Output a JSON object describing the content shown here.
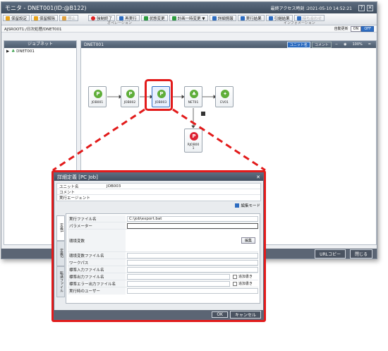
{
  "window": {
    "title": "モニタ - DNET001(ID:@B122)",
    "last_access": "最終アクセス時刻 :2021-05-10 14:52:21"
  },
  "toolbar": {
    "buttons": [
      {
        "label": "保留設定",
        "color": "#e6a21c",
        "disabled": false
      },
      {
        "label": "保留解除",
        "color": "#e6a21c",
        "disabled": false
      },
      {
        "label": "停止",
        "color": "#bbbbbb",
        "disabled": true
      },
      {
        "label": "強制終了",
        "color": "#d22",
        "disabled": false
      },
      {
        "label": "再実行",
        "color": "#2d6cc0",
        "disabled": false
      },
      {
        "label": "状態変更",
        "color": "#2d9a3f",
        "disabled": false
      },
      {
        "label": "計画一時変更 ▼",
        "color": "#2d9a3f",
        "disabled": false
      },
      {
        "label": "詳細情報",
        "color": "#2d6cc0",
        "disabled": false
      },
      {
        "label": "実行結果",
        "color": "#2d6cc0",
        "disabled": false
      },
      {
        "label": "引継結果",
        "color": "#2d6cc0",
        "disabled": false
      },
      {
        "label": "待ち合わせ",
        "color": "#bbbbbb",
        "disabled": true
      }
    ],
    "group_operation": "オペレーション",
    "group_information": "インフォメーション"
  },
  "breadcrumb": {
    "path": "AJSROOT1:/日次処理/DNET001",
    "auto_update_label": "自動更新",
    "on": "ON",
    "off": "OFF"
  },
  "sidebar": {
    "title": "ジョブネット",
    "tree": [
      {
        "label": "DNET001"
      }
    ]
  },
  "canvas": {
    "title": "DNET001",
    "unit_name_btn": "ユニット名",
    "comment_btn": "コメント",
    "zoom": "100%",
    "nodes": [
      {
        "label": "JOB001"
      },
      {
        "label": "JOB002"
      },
      {
        "label": "JOB003"
      },
      {
        "label": "NET01"
      },
      {
        "label": "EV01"
      },
      {
        "label": "RJOB00\n1"
      }
    ]
  },
  "footer": {
    "url_copy": "URLコピー",
    "close": "閉じる"
  },
  "dialog": {
    "title": "詳細定義 [PC Job]",
    "unit_name_label": "ユニット名",
    "unit_name_value": "JOB003",
    "comment_label": "コメント",
    "comment_value": "",
    "agent_label": "実行エージェント",
    "agent_value": "",
    "edit_mode_label": "編集モード",
    "tabs": [
      "定義1",
      "定義2",
      "転送ファイル"
    ],
    "fields": {
      "exec_file_label": "実行ファイル名",
      "exec_file_value": "C:\\job\\export.bat",
      "params_label": "パラメーター",
      "env_label": "環境変数",
      "env_edit_btn": "編集",
      "env_file_label": "環境変数ファイル名",
      "workpath_label": "ワークパス",
      "stdin_label": "標準入力ファイル名",
      "stdout_label": "標準出力ファイル名",
      "stderr_label": "標準エラー出力ファイル名",
      "user_label": "実行時のユーザー",
      "append_label": "追加書き"
    },
    "ok": "OK",
    "cancel": "キャンセル"
  }
}
